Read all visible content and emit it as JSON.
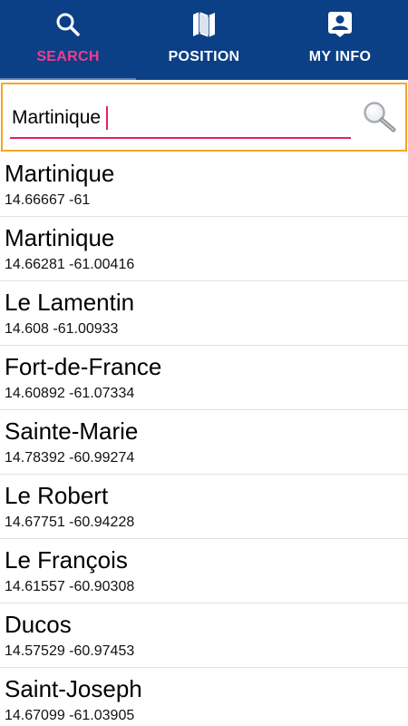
{
  "tabs": [
    {
      "label": "SEARCH",
      "icon": "search-icon",
      "active": true
    },
    {
      "label": "POSITION",
      "icon": "map-icon",
      "active": false
    },
    {
      "label": "MY INFO",
      "icon": "account-box-icon",
      "active": false
    }
  ],
  "colors": {
    "tabbar_bg": "#0b3f86",
    "active_tab": "#ee3d8e",
    "focus_border": "#f5a623",
    "input_underline": "#e91e63"
  },
  "search": {
    "value": "Martinique",
    "button_icon": "magnifier-icon"
  },
  "results": [
    {
      "name": "Martinique",
      "coords": "14.66667 -61"
    },
    {
      "name": "Martinique",
      "coords": "14.66281 -61.00416"
    },
    {
      "name": "Le Lamentin",
      "coords": "14.608 -61.00933"
    },
    {
      "name": "Fort-de-France",
      "coords": "14.60892 -61.07334"
    },
    {
      "name": "Sainte-Marie",
      "coords": "14.78392 -60.99274"
    },
    {
      "name": "Le Robert",
      "coords": "14.67751 -60.94228"
    },
    {
      "name": "Le François",
      "coords": "14.61557 -60.90308"
    },
    {
      "name": "Ducos",
      "coords": "14.57529 -60.97453"
    },
    {
      "name": "Saint-Joseph",
      "coords": "14.67099 -61.03905"
    }
  ]
}
